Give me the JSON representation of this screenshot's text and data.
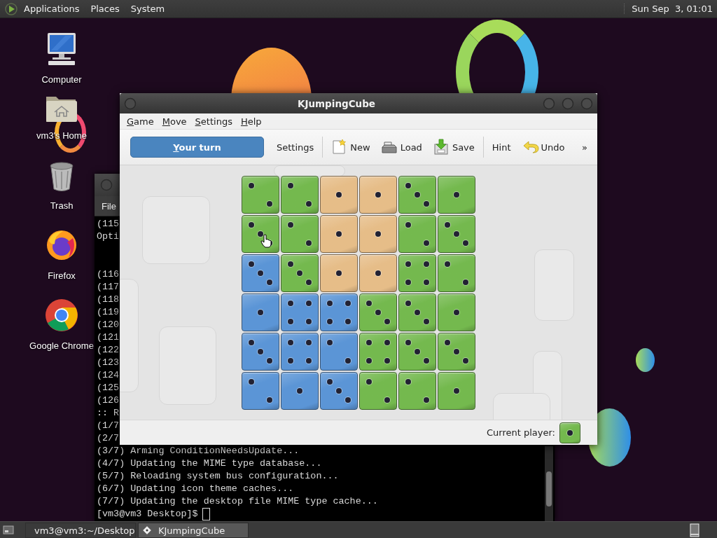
{
  "top_panel": {
    "menus": [
      "Applications",
      "Places",
      "System"
    ],
    "clock": "Sun Sep  3, 01:01"
  },
  "desktop_icons": [
    {
      "label": "Computer",
      "kind": "computer"
    },
    {
      "label": "vm3's Home",
      "kind": "home"
    },
    {
      "label": "Trash",
      "kind": "trash"
    },
    {
      "label": "Firefox",
      "kind": "firefox"
    },
    {
      "label": "Google Chrome",
      "kind": "chrome"
    }
  ],
  "terminal": {
    "menus": [
      "File"
    ],
    "output_top": [
      "(115",
      "Opti"
    ],
    "output": [
      "(116",
      "(117",
      "(118",
      "(119",
      "(120",
      "(121",
      "(122",
      "(123",
      "(124",
      "(125",
      "(126",
      ":: R",
      "(1/7",
      "(2/7",
      "(3/7) Arming ConditionNeedsUpdate...",
      "(4/7) Updating the MIME type database...",
      "(5/7) Reloading system bus configuration...",
      "(6/7) Updating icon theme caches...",
      "(7/7) Updating the desktop file MIME type cache..."
    ],
    "prompt": "[vm3@vm3 Desktop]$"
  },
  "game_window": {
    "title": "KJumpingCube",
    "menus": [
      "Game",
      "Move",
      "Settings",
      "Help"
    ],
    "toolbar": [
      {
        "kind": "status",
        "label": "Your turn"
      },
      {
        "kind": "text",
        "label": "Settings"
      },
      {
        "kind": "separator"
      },
      {
        "kind": "new",
        "label": "New"
      },
      {
        "kind": "load",
        "label": "Load"
      },
      {
        "kind": "save",
        "label": "Save"
      },
      {
        "kind": "separator"
      },
      {
        "kind": "text",
        "label": "Hint"
      },
      {
        "kind": "undo",
        "label": "Undo"
      },
      {
        "kind": "overflow",
        "label": "»"
      }
    ],
    "board": [
      [
        {
          "color": "#74b94e",
          "kind": "two"
        },
        {
          "color": "#74b94e",
          "kind": "two"
        },
        {
          "color": "#e6bd88",
          "kind": "one"
        },
        {
          "color": "#e6bd88",
          "kind": "one"
        },
        {
          "color": "#74b94e",
          "kind": "three"
        },
        {
          "color": "#74b94e",
          "kind": "one"
        }
      ],
      [
        {
          "color": "#74b94e",
          "kind": "three"
        },
        {
          "color": "#74b94e",
          "kind": "two"
        },
        {
          "color": "#e6bd88",
          "kind": "one"
        },
        {
          "color": "#e6bd88",
          "kind": "one"
        },
        {
          "color": "#74b94e",
          "kind": "two"
        },
        {
          "color": "#74b94e",
          "kind": "three"
        }
      ],
      [
        {
          "color": "#5b95d6",
          "kind": "three"
        },
        {
          "color": "#74b94e",
          "kind": "three"
        },
        {
          "color": "#e6bd88",
          "kind": "one"
        },
        {
          "color": "#e6bd88",
          "kind": "one"
        },
        {
          "color": "#74b94e",
          "kind": "four"
        },
        {
          "color": "#74b94e",
          "kind": "two"
        }
      ],
      [
        {
          "color": "#5b95d6",
          "kind": "one"
        },
        {
          "color": "#5b95d6",
          "kind": "four"
        },
        {
          "color": "#5b95d6",
          "kind": "four"
        },
        {
          "color": "#74b94e",
          "kind": "three"
        },
        {
          "color": "#74b94e",
          "kind": "three"
        },
        {
          "color": "#74b94e",
          "kind": "one"
        }
      ],
      [
        {
          "color": "#5b95d6",
          "kind": "three"
        },
        {
          "color": "#5b95d6",
          "kind": "four"
        },
        {
          "color": "#5b95d6",
          "kind": "two"
        },
        {
          "color": "#74b94e",
          "kind": "four"
        },
        {
          "color": "#74b94e",
          "kind": "three"
        },
        {
          "color": "#74b94e",
          "kind": "three"
        }
      ],
      [
        {
          "color": "#5b95d6",
          "kind": "two"
        },
        {
          "color": "#5b95d6",
          "kind": "one"
        },
        {
          "color": "#5b95d6",
          "kind": "three"
        },
        {
          "color": "#74b94e",
          "kind": "two"
        },
        {
          "color": "#74b94e",
          "kind": "two"
        },
        {
          "color": "#74b94e",
          "kind": "one"
        }
      ]
    ],
    "status_bar": {
      "label": "Current player:",
      "current_player": {
        "color": "#74b94e",
        "kind": "one"
      }
    }
  },
  "taskbar": {
    "tasks": [
      {
        "label": "vm3@vm3:~/Desktop",
        "kind": "terminal",
        "selected": false
      },
      {
        "label": "KJumpingCube",
        "kind": "game",
        "selected": true
      }
    ]
  }
}
